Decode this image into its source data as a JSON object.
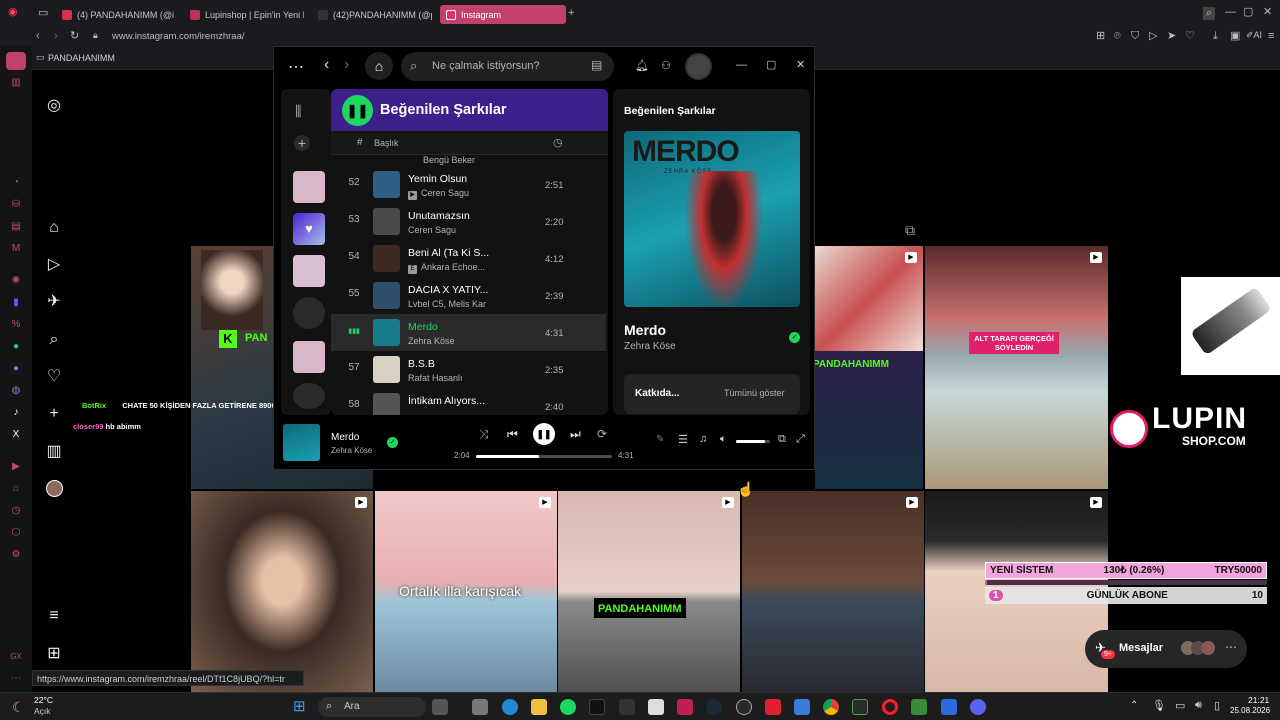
{
  "browser": {
    "tabs": [
      {
        "label": "(4) PANDAHANIMM (@irem",
        "color": "#d7324a"
      },
      {
        "label": "Lupinshop | Epin'in Yeni M",
        "color": "#c0305a"
      },
      {
        "label": "(42)PANDAHANIMM (@pa",
        "color": "#222"
      },
      {
        "label": "Instagram",
        "color": "#e1306c"
      }
    ],
    "add_tab_label": "+",
    "url": "www.instagram.com/iremzhraa/",
    "bookmark_label": "PANDAHANIMM",
    "status_url": "https://www.instagram.com/iremzhraa/reel/DTf1C8jUBQ/?hl=tr"
  },
  "spotify": {
    "search_placeholder": "Ne çalmak istiyorsun?",
    "playlist_title": "Beğenilen Şarkılar",
    "header_hash": "#",
    "header_title": "Başlık",
    "partial_artist": "Bengü Beker",
    "tracks": [
      {
        "num": "52",
        "title": "Yemin Olsun",
        "artist": "Ceren Sagu",
        "duration": "2:51",
        "explicit": "▶",
        "art": "#2e5f86"
      },
      {
        "num": "53",
        "title": "Unutamazsın",
        "artist": "Ceren Sagu",
        "duration": "2:20",
        "explicit": "",
        "art": "#4a4a4a"
      },
      {
        "num": "54",
        "title": "Beni Al (Ta Ki S...",
        "artist": "Ankara Echoe...",
        "duration": "4:12",
        "explicit": "E",
        "art": "#3b2a1f"
      },
      {
        "num": "55",
        "title": "DACIA X YATIY...",
        "artist": "Lvbel C5, Melis Kar",
        "duration": "2:39",
        "explicit": "",
        "art": "#2f4f6e"
      },
      {
        "num": "",
        "title": "Merdo",
        "artist": "Zehra Köse",
        "duration": "4:31",
        "explicit": "",
        "art": "#177a8a",
        "playing": true
      },
      {
        "num": "57",
        "title": "B.S.B",
        "artist": "Rafat Hasanlı",
        "duration": "2:35",
        "explicit": "",
        "art": "#d8d0c0"
      },
      {
        "num": "58",
        "title": "İntikam Alıyors...",
        "artist": "",
        "duration": "2:40",
        "explicit": "",
        "art": "#555"
      }
    ],
    "right_panel": {
      "heading": "Beğenilen Şarkılar",
      "cover_text": "MERDO",
      "cover_subtext": "ZEHRA KÖSE",
      "song": "Merdo",
      "artist": "Zehra Köse",
      "credits_label": "Katkıda...",
      "show_all": "Tümünü göster"
    },
    "player": {
      "title": "Merdo",
      "artist": "Zehra Köse",
      "elapsed": "2:04",
      "total": "4:31",
      "progress": 0.46,
      "volume": 0.85
    }
  },
  "overlays": {
    "chat": [
      {
        "user": "BotRix",
        "message": "CHATE 50 KİŞİDEN FAZLA GETİRENE 8900 VP"
      },
      {
        "user": "closer99",
        "message": "hb abimm"
      }
    ],
    "stream_tag": "PANDAHANIMM",
    "stream_tag_short": "PAN",
    "alt_caption": "ALT TARAFI GERÇEĞİ SÖYLEDİN",
    "caption": "Ortalık illa karışıcak",
    "lupin_main": "LUPIN",
    "lupin_sub": "SHOP.COM",
    "stats": {
      "left": "YENİ SİSTEM",
      "mid": "130₺ (0.26%)",
      "right": "TRY50000",
      "progress": 0.0026,
      "row2_num": "1",
      "row2_label": "GÜNLÜK ABONE",
      "row2_count": "10"
    },
    "messages_label": "Mesajlar",
    "messages_badge": "9+",
    "nav_badge": "9+"
  },
  "taskbar": {
    "temp": "22°C",
    "weather": "Açık",
    "search": "Ara",
    "time": "21:21",
    "date": "25.08.2026"
  }
}
